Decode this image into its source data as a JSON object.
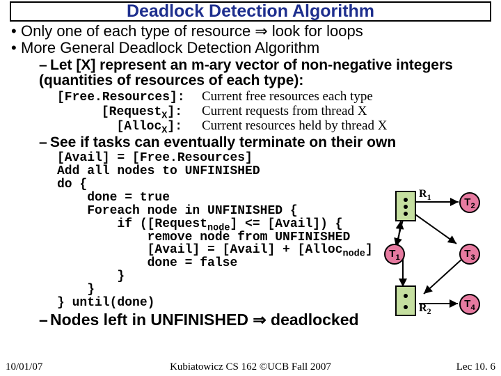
{
  "title": "Deadlock Detection Algorithm",
  "bullets": {
    "b1": "Only one of each type of resource ⇒ look for loops",
    "b2": "More General Deadlock Detection Algorithm"
  },
  "dash1": "Let [X] represent an m-ary vector of non-negative integers (quantities of resources of each type):",
  "defs": {
    "l1": "[Free.Resources]:",
    "d1": "Current free resources each type",
    "l2_a": "[Request",
    "l2_b": "]:",
    "d2": "Current requests from thread X",
    "l3_a": "[Alloc",
    "l3_b": "]:",
    "d3": "Current resources held by thread X",
    "sub": "X"
  },
  "dash2": "See if tasks can eventually terminate on their own",
  "code": {
    "ln1": "[Avail] = [Free.Resources]",
    "ln2": "Add all nodes to UNFINISHED",
    "ln3": "do {",
    "ln4": "    done = true",
    "ln5": "    Foreach node in UNFINISHED {",
    "ln6a": "        if ([Request",
    "ln6b": "] <= [Avail]) {",
    "ln7": "            remove node from UNFINISHED",
    "ln8a": "            [Avail] = [Avail] + [Alloc",
    "ln8b": "]",
    "ln9": "            done = false",
    "ln10": "        }",
    "ln11": "    }",
    "ln12": "} until(done)",
    "sub": "node"
  },
  "dash3": "Nodes left in UNFINISHED ⇒ deadlocked",
  "diagram": {
    "R1": "R",
    "R1s": "1",
    "R2": "R",
    "R2s": "2",
    "T1": "T",
    "T1s": "1",
    "T2": "T",
    "T2s": "2",
    "T3": "T",
    "T3s": "3",
    "T4": "T",
    "T4s": "4"
  },
  "footer": {
    "date": "10/01/07",
    "mid": "Kubiatowicz CS 162 ©UCB Fall 2007",
    "lec": "Lec 10. 6"
  }
}
